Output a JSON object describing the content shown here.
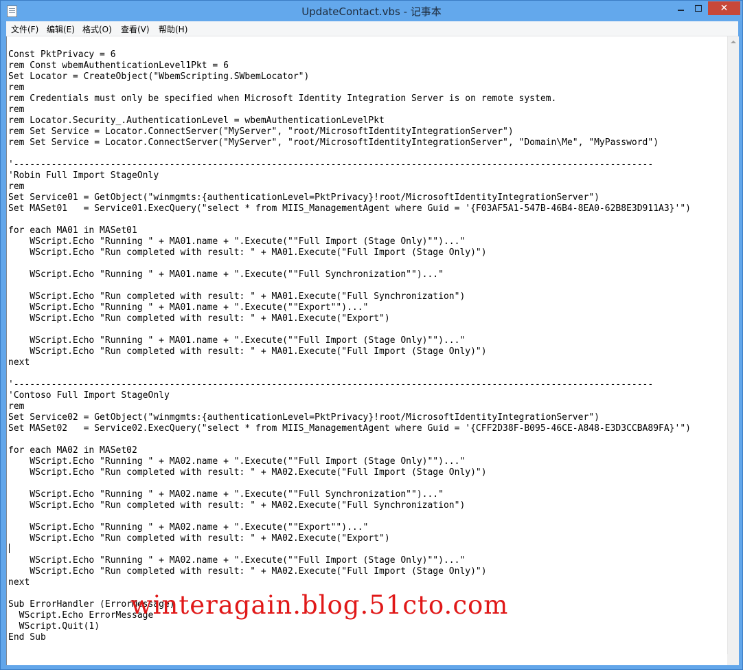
{
  "window": {
    "title": "UpdateContact.vbs - 记事本",
    "controls": {
      "minimize": "",
      "maximize": "",
      "close": "✕"
    }
  },
  "menu": {
    "file": "文件(F)",
    "edit": "编辑(E)",
    "format": "格式(O)",
    "view": "查看(V)",
    "help": "帮助(H)"
  },
  "editor": {
    "content": "Const PktPrivacy = 6\nrem Const wbemAuthenticationLevel1Pkt = 6\nSet Locator = CreateObject(\"WbemScripting.SWbemLocator\")\nrem\nrem Credentials must only be specified when Microsoft Identity Integration Server is on remote system.\nrem\nrem Locator.Security_.AuthenticationLevel = wbemAuthenticationLevelPkt\nrem Set Service = Locator.ConnectServer(\"MyServer\", \"root/MicrosoftIdentityIntegrationServer\")\nrem Set Service = Locator.ConnectServer(\"MyServer\", \"root/MicrosoftIdentityIntegrationServer\", \"Domain\\Me\", \"MyPassword\")\n\n'-----------------------------------------------------------------------------------------------------------------------\n'Robin Full Import StageOnly\nrem\nSet Service01 = GetObject(\"winmgmts:{authenticationLevel=PktPrivacy}!root/MicrosoftIdentityIntegrationServer\")\nSet MASet01   = Service01.ExecQuery(\"select * from MIIS_ManagementAgent where Guid = '{F03AF5A1-547B-46B4-8EA0-62B8E3D911A3}'\")\n\nfor each MA01 in MASet01\n    WScript.Echo \"Running \" + MA01.name + \".Execute(\"\"Full Import (Stage Only)\"\")...\"\n    WScript.Echo \"Run completed with result: \" + MA01.Execute(\"Full Import (Stage Only)\")\n\n    WScript.Echo \"Running \" + MA01.name + \".Execute(\"\"Full Synchronization\"\")...\"\n\n    WScript.Echo \"Run completed with result: \" + MA01.Execute(\"Full Synchronization\")\n    WScript.Echo \"Running \" + MA01.name + \".Execute(\"\"Export\"\")...\"\n    WScript.Echo \"Run completed with result: \" + MA01.Execute(\"Export\")\n\n    WScript.Echo \"Running \" + MA01.name + \".Execute(\"\"Full Import (Stage Only)\"\")...\"\n    WScript.Echo \"Run completed with result: \" + MA01.Execute(\"Full Import (Stage Only)\")\nnext\n\n'-----------------------------------------------------------------------------------------------------------------------\n'Contoso Full Import StageOnly\nrem\nSet Service02 = GetObject(\"winmgmts:{authenticationLevel=PktPrivacy}!root/MicrosoftIdentityIntegrationServer\")\nSet MASet02   = Service02.ExecQuery(\"select * from MIIS_ManagementAgent where Guid = '{CFF2D38F-B095-46CE-A848-E3D3CCBA89FA}'\")\n\nfor each MA02 in MASet02\n    WScript.Echo \"Running \" + MA02.name + \".Execute(\"\"Full Import (Stage Only)\"\")...\"\n    WScript.Echo \"Run completed with result: \" + MA02.Execute(\"Full Import (Stage Only)\")\n\n    WScript.Echo \"Running \" + MA02.name + \".Execute(\"\"Full Synchronization\"\")...\"\n    WScript.Echo \"Run completed with result: \" + MA02.Execute(\"Full Synchronization\")\n\n    WScript.Echo \"Running \" + MA02.name + \".Execute(\"\"Export\"\")...\"\n    WScript.Echo \"Run completed with result: \" + MA02.Execute(\"Export\")\n\n    WScript.Echo \"Running \" + MA02.name + \".Execute(\"\"Full Import (Stage Only)\"\")...\"\n    WScript.Echo \"Run completed with result: \" + MA02.Execute(\"Full Import (Stage Only)\")\nnext\n\nSub ErrorHandler (ErrorMessage)\n  WScript.Echo ErrorMessage\n  WScript.Quit(1)\nEnd Sub",
    "watermark": "winteragain.blog.51cto.com"
  }
}
